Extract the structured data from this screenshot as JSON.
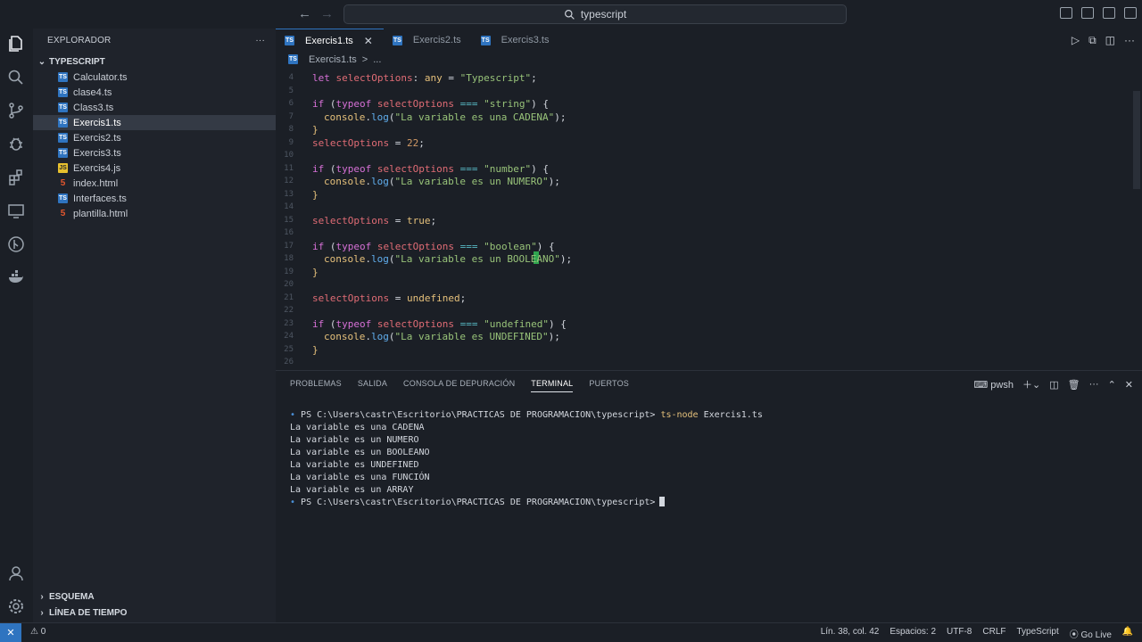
{
  "titlebar": {
    "search_text": "typescript"
  },
  "activity_bar": {
    "items": [
      "explorer-icon",
      "search-icon",
      "source-control-icon",
      "run-debug-icon",
      "extensions-icon",
      "remote-explorer-icon",
      "git-graph-icon",
      "docker-icon"
    ],
    "bottom_items": [
      "account-icon",
      "settings-gear-icon"
    ]
  },
  "sidebar": {
    "title": "EXPLORADOR",
    "more": "···",
    "folder": "TYPESCRIPT",
    "files": [
      {
        "name": "Calculator.ts",
        "type": "ts"
      },
      {
        "name": "clase4.ts",
        "type": "ts"
      },
      {
        "name": "Class3.ts",
        "type": "ts"
      },
      {
        "name": "Exercis1.ts",
        "type": "ts",
        "active": true
      },
      {
        "name": "Exercis2.ts",
        "type": "ts"
      },
      {
        "name": "Exercis3.ts",
        "type": "ts"
      },
      {
        "name": "Exercis4.js",
        "type": "js"
      },
      {
        "name": "index.html",
        "type": "html"
      },
      {
        "name": "Interfaces.ts",
        "type": "ts"
      },
      {
        "name": "plantilla.html",
        "type": "html"
      }
    ],
    "outline": "ESQUEMA",
    "timeline": "LÍNEA DE TIEMPO"
  },
  "editor": {
    "tabs": [
      {
        "label": "Exercis1.ts",
        "active": true,
        "close": "✕"
      },
      {
        "label": "Exercis2.ts"
      },
      {
        "label": "Exercis3.ts"
      }
    ],
    "breadcrumb": {
      "file": "Exercis1.ts",
      "sep": ">",
      "rest": "..."
    },
    "line_numbers": [
      "4",
      "5",
      "6",
      "7",
      "8",
      "9",
      "10",
      "11",
      "12",
      "13",
      "14",
      "15",
      "16",
      "17",
      "18",
      "19",
      "20",
      "21",
      "22",
      "23",
      "24",
      "25",
      "26"
    ],
    "code": {
      "l4": [
        "let",
        " ",
        "selectOptions",
        ": ",
        "any",
        " = ",
        "\"Typescript\"",
        ";"
      ],
      "l6": [
        "if",
        " (",
        "typeof",
        " ",
        "selectOptions",
        " === ",
        "\"string\"",
        ") {"
      ],
      "l7": [
        "console",
        ".",
        "log",
        "(",
        "\"La variable es una CADENA\"",
        ");"
      ],
      "l8": "}",
      "l9": [
        "selectOptions",
        " = ",
        "22",
        ";"
      ],
      "l11": [
        "if",
        " (",
        "typeof",
        " ",
        "selectOptions",
        " === ",
        "\"number\"",
        ") {"
      ],
      "l12": [
        "console",
        ".",
        "log",
        "(",
        "\"La variable es un NUMERO\"",
        ");"
      ],
      "l13": "}",
      "l15": [
        "selectOptions",
        " = ",
        "true",
        ";"
      ],
      "l17": [
        "if",
        " (",
        "typeof",
        " ",
        "selectOptions",
        " === ",
        "\"boolean\"",
        ") {"
      ],
      "l18": [
        "console",
        ".",
        "log",
        "(",
        "\"La variable es un BOOLEANO\"",
        ");"
      ],
      "l19": "}",
      "l21": [
        "selectOptions",
        " = ",
        "undefined",
        ";"
      ],
      "l23": [
        "if",
        " (",
        "typeof",
        " ",
        "selectOptions",
        " === ",
        "\"undefined\"",
        ") {"
      ],
      "l24": [
        "console",
        ".",
        "log",
        "(",
        "\"La variable es UNDEFINED\"",
        ");"
      ],
      "l25": "}"
    }
  },
  "panel": {
    "tabs": [
      "PROBLEMAS",
      "SALIDA",
      "CONSOLA DE DEPURACIÓN",
      "TERMINAL",
      "PUERTOS"
    ],
    "active_tab": "TERMINAL",
    "shell": "pwsh",
    "terminal": {
      "prompt": "PS C:\\Users\\castr\\Escritorio\\PRACTICAS DE PROGRAMACION\\typescript>",
      "command": "ts-node",
      "arg": "Exercis1.ts",
      "output": [
        "La variable es una CADENA",
        "La variable es un NUMERO",
        "La variable es un BOOLEANO",
        "La variable es UNDEFINED",
        "La variable es una FUNCIÓN",
        "La variable es un ARRAY"
      ]
    }
  },
  "status": {
    "remote": "✕",
    "problems": "0",
    "position": "Lín. 38, col. 42",
    "spaces": "Espacios: 2",
    "encoding": "UTF-8",
    "eol": "CRLF",
    "language": "TypeScript",
    "golive": "Go Live"
  }
}
